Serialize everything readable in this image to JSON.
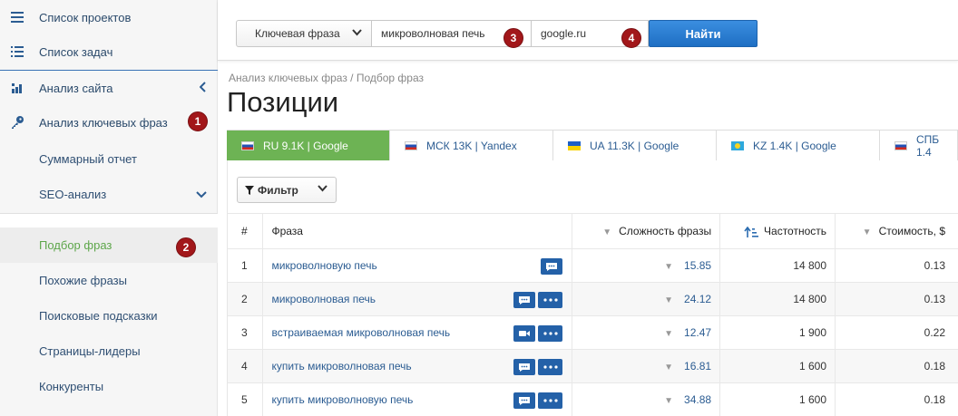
{
  "sidebar": {
    "items": [
      {
        "label": "Список проектов",
        "icon": "menu-icon"
      },
      {
        "label": "Список задач",
        "icon": "list-icon"
      },
      {
        "label": "Анализ сайта",
        "icon": "chart-icon"
      },
      {
        "label": "Анализ ключевых фраз",
        "icon": "key-icon",
        "badge": "1"
      },
      {
        "label": "Суммарный отчет"
      },
      {
        "label": "SEO-анализ"
      },
      {
        "label": "Подбор фраз",
        "badge": "2"
      },
      {
        "label": "Похожие фразы"
      },
      {
        "label": "Поисковые подсказки"
      },
      {
        "label": "Страницы-лидеры"
      },
      {
        "label": "Конкуренты"
      }
    ]
  },
  "search": {
    "mode": "Ключевая фраза",
    "phrase": "микроволновая печь",
    "phrase_badge": "3",
    "domain": "google.ru",
    "domain_badge": "4",
    "submit": "Найти"
  },
  "breadcrumb": "Анализ ключевых фраз / Подбор фраз",
  "page_title": "Позиции",
  "tabs": [
    {
      "label": "RU 9.1K | Google",
      "flag": "ru",
      "active": true
    },
    {
      "label": "МСК 13K | Yandex",
      "flag": "ru"
    },
    {
      "label": "UA 11.3K | Google",
      "flag": "ua"
    },
    {
      "label": "KZ 1.4K | Google",
      "flag": "kz"
    },
    {
      "label": "СПБ 1.4",
      "flag": "ru"
    }
  ],
  "filter_label": "Фильтр",
  "table": {
    "headers": {
      "num": "#",
      "phrase": "Фраза",
      "difficulty": "Сложность фразы",
      "frequency": "Частотность",
      "cost": "Стоимость, $"
    },
    "rows": [
      {
        "num": "1",
        "phrase": "микроволновую печь",
        "difficulty": "15.85",
        "frequency": "14 800",
        "cost": "0.13",
        "actions": [
          "chat"
        ]
      },
      {
        "num": "2",
        "phrase": "микроволновая печь",
        "difficulty": "24.12",
        "frequency": "14 800",
        "cost": "0.13",
        "actions": [
          "chat",
          "more"
        ]
      },
      {
        "num": "3",
        "phrase": "встраиваемая микроволновая печь",
        "difficulty": "12.47",
        "frequency": "1 900",
        "cost": "0.22",
        "actions": [
          "video",
          "more"
        ]
      },
      {
        "num": "4",
        "phrase": "купить микроволновая печь",
        "difficulty": "16.81",
        "frequency": "1 600",
        "cost": "0.18",
        "actions": [
          "chat",
          "more"
        ]
      },
      {
        "num": "5",
        "phrase": "купить микроволновую печь",
        "difficulty": "34.88",
        "frequency": "1 600",
        "cost": "0.18",
        "actions": [
          "chat",
          "more"
        ]
      }
    ]
  }
}
